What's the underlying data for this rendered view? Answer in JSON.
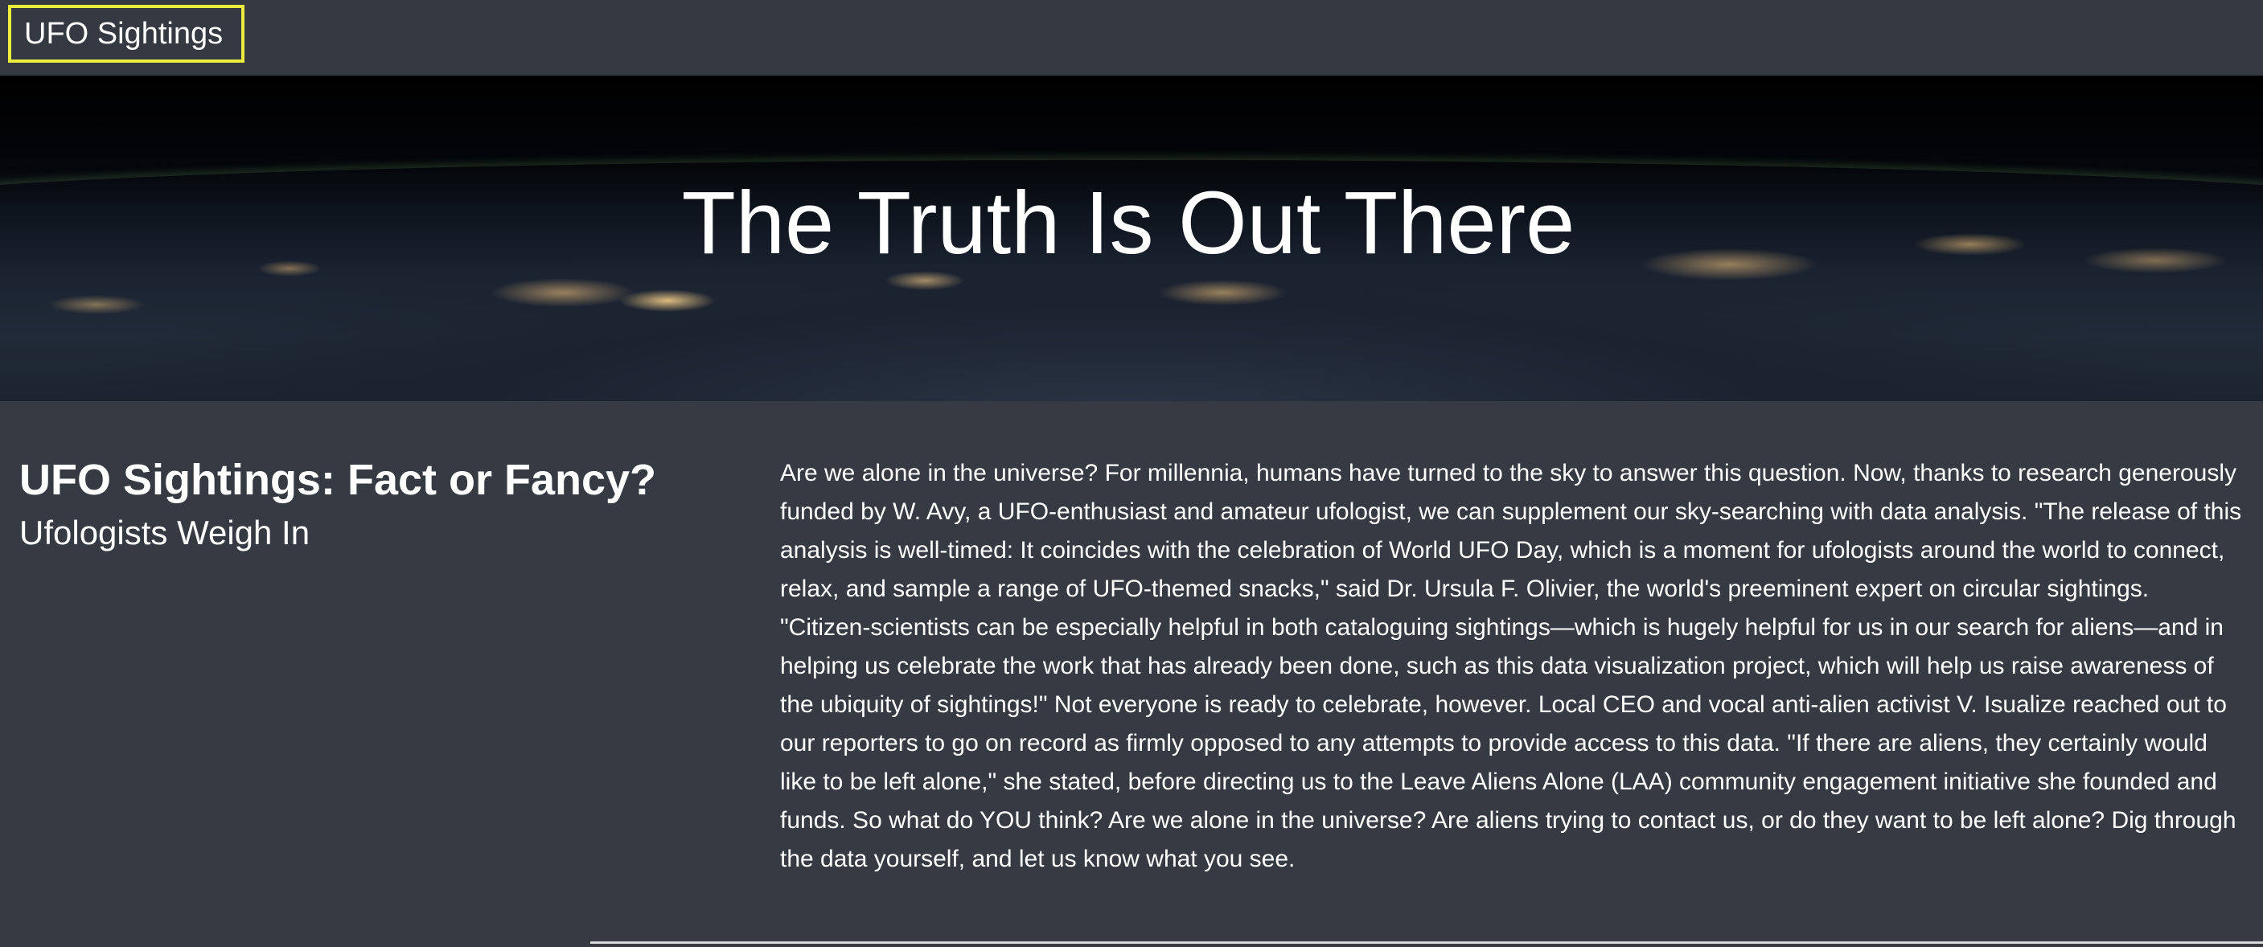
{
  "navbar": {
    "brand": "UFO Sightings"
  },
  "hero": {
    "title": "The Truth Is Out There"
  },
  "article": {
    "headline": "UFO Sightings: Fact or Fancy?",
    "subheadline": "Ufologists Weigh In",
    "body": "Are we alone in the universe? For millennia, humans have turned to the sky to answer this question. Now, thanks to research generously funded by W. Avy, a UFO-enthusiast and amateur ufologist, we can supplement our sky-searching with data analysis. \"The release of this analysis is well-timed: It coincides with the celebration of World UFO Day, which is a moment for ufologists around the world to connect, relax, and sample a range of UFO-themed snacks,\" said Dr. Ursula F. Olivier, the world's preeminent expert on circular sightings. \"Citizen-scientists can be especially helpful in both cataloguing sightings—which is hugely helpful for us in our search for aliens—and in helping us celebrate the work that has already been done, such as this data visualization project, which will help us raise awareness of the ubiquity of sightings!\" Not everyone is ready to celebrate, however. Local CEO and vocal anti-alien activist V. Isualize reached out to our reporters to go on record as firmly opposed to any attempts to provide access to this data. \"If there are aliens, they certainly would like to be left alone,\" she stated, before directing us to the Leave Aliens Alone (LAA) community engagement initiative she founded and funds. So what do YOU think? Are we alone in the universe? Are aliens trying to contact us, or do they want to be left alone? Dig through the data yourself, and let us know what you see."
  },
  "colors": {
    "background": "#363b43",
    "navbar": "#353941",
    "brand_outline": "#ecec3c",
    "text": "#ffffff"
  }
}
